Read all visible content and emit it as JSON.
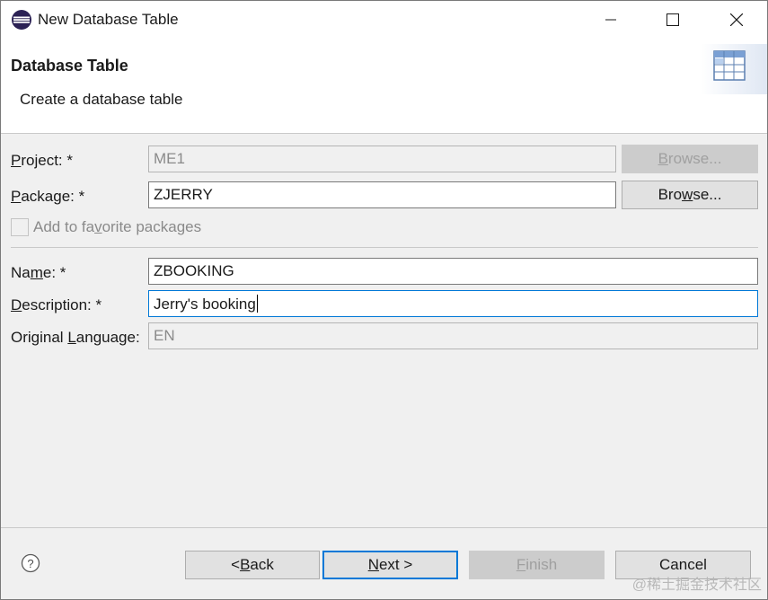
{
  "window": {
    "title": "New Database Table"
  },
  "banner": {
    "title": "Database Table",
    "description": "Create a database table"
  },
  "form": {
    "project": {
      "label_pre": "",
      "label_mn": "P",
      "label_post": "roject: *",
      "value": "ME1",
      "browse_pre": "",
      "browse_mn": "B",
      "browse_post": "rowse..."
    },
    "package": {
      "label_pre": "",
      "label_mn": "P",
      "label_post": "ackage: *",
      "value": "ZJERRY",
      "browse_pre": "Bro",
      "browse_mn": "w",
      "browse_post": "se..."
    },
    "favorite": {
      "label_pre": "Add to fa",
      "label_mn": "v",
      "label_post": "orite packages",
      "checked": false
    },
    "name": {
      "label_pre": "Na",
      "label_mn": "m",
      "label_post": "e: *",
      "value": "ZBOOKING"
    },
    "description": {
      "label_pre": "",
      "label_mn": "D",
      "label_post": "escription: *",
      "value": "Jerry's booking"
    },
    "original_language": {
      "label_pre": "Original ",
      "label_mn": "L",
      "label_post": "anguage:",
      "value": "EN"
    }
  },
  "buttons": {
    "back": {
      "pre": "< ",
      "mn": "B",
      "post": "ack"
    },
    "next": {
      "pre": "",
      "mn": "N",
      "post": "ext >"
    },
    "finish": {
      "pre": "",
      "mn": "F",
      "post": "inish"
    },
    "cancel": {
      "pre": "Cancel",
      "mn": "",
      "post": ""
    }
  },
  "watermark": "@稀土掘金技术社区",
  "colors": {
    "accent": "#0078d7",
    "banner_bg": "#ffffff",
    "dialog_bg": "#f0f0f0"
  }
}
